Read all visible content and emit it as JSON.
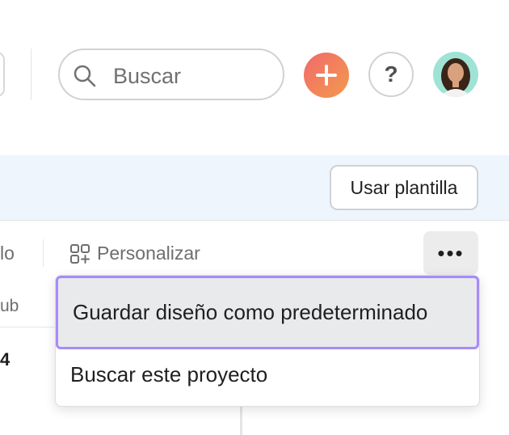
{
  "topbar": {
    "search_placeholder": "Buscar",
    "add_icon": "plus-icon",
    "help_label": "?",
    "avatar_icon": "user-avatar"
  },
  "banner": {
    "use_template_label": "Usar plantilla"
  },
  "toolbar": {
    "cut_label": "lo",
    "customize_label": "Personalizar",
    "more_label": "•••"
  },
  "table": {
    "column_header_cut": "ub",
    "cell_cut": "4"
  },
  "menu": {
    "items": [
      {
        "label": "Guardar diseño como predeterminado"
      },
      {
        "label": "Buscar este proyecto"
      }
    ]
  },
  "colors": {
    "accent_gradient_start": "#f06a6a",
    "accent_gradient_end": "#f39a4d",
    "focus_outline": "#a78bfa",
    "banner_bg": "#eef5fd"
  }
}
